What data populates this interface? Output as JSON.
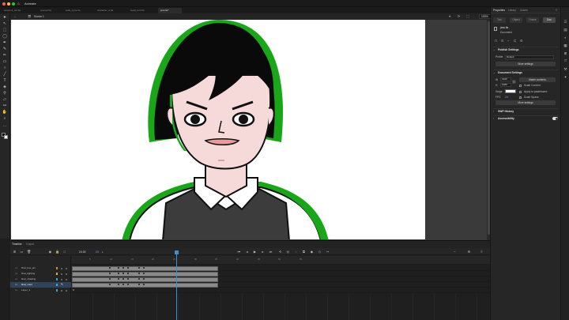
{
  "window": {
    "app_name": "Animate",
    "traffic_lights": [
      "#ff5f57",
      "#febc2e",
      "#28c840"
    ]
  },
  "doc_tabs": [
    {
      "label": "assets-4_ani.fla"
    },
    {
      "label": "scene2.fla"
    },
    {
      "label": "walk_cycle.fla"
    },
    {
      "label": "character_A.fla"
    },
    {
      "label": "head_turn.fla"
    },
    {
      "label": "jess.fla*"
    }
  ],
  "stage_header": {
    "scene": "Scene 1",
    "zoom": "100%"
  },
  "panel": {
    "tabs": [
      "Properties",
      "Library",
      "Assets"
    ],
    "active_tab": "Properties",
    "segments": [
      "Tool",
      "Object",
      "Frame",
      "Doc"
    ],
    "active_segment": "Doc",
    "doc_name": "jess.fla",
    "doc_type": "Document",
    "publish_settings": {
      "title": "Publish Settings",
      "profile_label": "Profile",
      "profile_value": "Default",
      "more_button": "More settings"
    },
    "document_settings": {
      "title": "Document Settings",
      "width_label": "W",
      "width": "1920",
      "height_label": "H",
      "height": "1080",
      "match_button": "Match contents",
      "scale_content": "Scale Content",
      "stage_label": "Stage",
      "apply_pasteboard": "Apply to pasteboard",
      "fps_label": "FPS",
      "fps": "24",
      "scale_spans": "Scale Spans",
      "more_button": "More settings"
    },
    "swf_history": "SWF History",
    "accessibility": "Accessibility"
  },
  "timeline": {
    "tabs": [
      "Timeline",
      "Output"
    ],
    "active_tab": "Timeline",
    "current_frame": "24.00",
    "fps_value": "24",
    "ruler_numbers": [
      "5",
      "10",
      "15",
      "20",
      "25",
      "30",
      "35",
      "40",
      "45",
      "50",
      "55"
    ],
    "layers": [
      {
        "name": "final_line_art",
        "color": "#e08a2a",
        "selected": false
      },
      {
        "name": "final_lighting",
        "color": "#e0b12a",
        "selected": false
      },
      {
        "name": "final_shading",
        "color": "#3aa0e0",
        "selected": false
      },
      {
        "name": "final_color",
        "color": "#3aa0e0",
        "selected": true
      },
      {
        "name": "Layer_1",
        "color": "#3aa0e0",
        "selected": false
      }
    ]
  },
  "colors": {
    "accent": "#3b8fd9",
    "rim_light": "#19a619",
    "hair": "#0a0a0a",
    "skin": "#f6d9d9"
  }
}
